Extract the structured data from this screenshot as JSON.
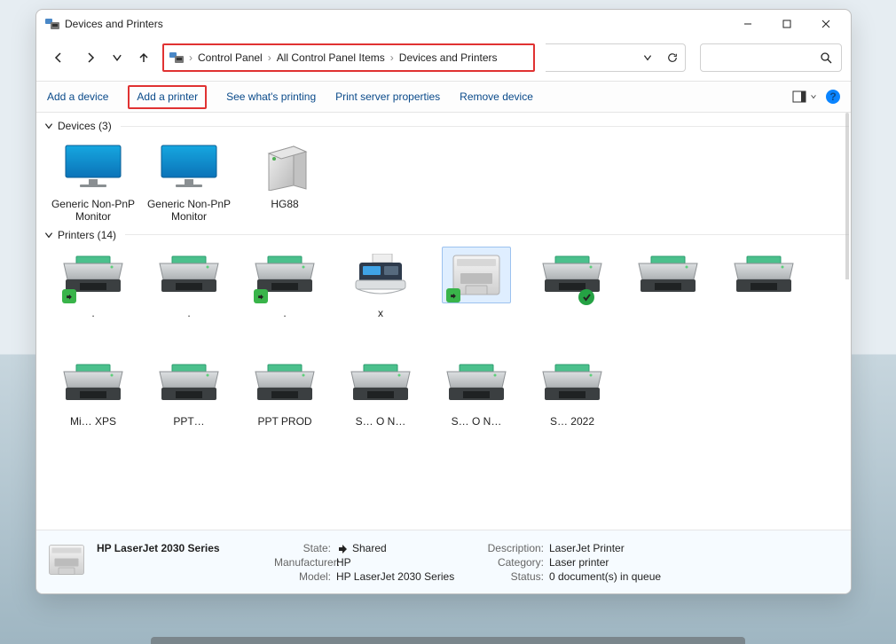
{
  "title": "Devices and Printers",
  "breadcrumbs": [
    "Control Panel",
    "All Control Panel Items",
    "Devices and Printers"
  ],
  "toolbar": {
    "add_device": "Add a device",
    "add_printer": "Add a printer",
    "see_printing": "See what's printing",
    "server_props": "Print server properties",
    "remove": "Remove device"
  },
  "groups": {
    "devices": {
      "label": "Devices",
      "count": 3,
      "items": [
        {
          "name": "Generic Non-PnP Monitor",
          "icon": "monitor"
        },
        {
          "name": "Generic Non-PnP Monitor",
          "icon": "monitor"
        },
        {
          "name": "HG88",
          "icon": "pc"
        }
      ]
    },
    "printers": {
      "label": "Printers",
      "count": 14,
      "row1": [
        {
          "name": ".",
          "icon": "printer",
          "share": true
        },
        {
          "name": ".",
          "icon": "printer"
        },
        {
          "name": ".",
          "icon": "printer",
          "share": true
        },
        {
          "name": "x",
          "icon": "fax"
        },
        {
          "name": "",
          "icon": "hpbox",
          "share": true,
          "selected": true
        },
        {
          "name": "",
          "icon": "printer",
          "check": true
        },
        {
          "name": "",
          "icon": "printer"
        },
        {
          "name": "",
          "icon": "printer"
        }
      ],
      "row2": [
        {
          "name": "Mi…  XPS",
          "icon": "printer"
        },
        {
          "name": "PPT…",
          "icon": "printer"
        },
        {
          "name": "PPT PROD",
          "icon": "printer"
        },
        {
          "name": "S…  O  N…",
          "icon": "printer"
        },
        {
          "name": "S…  O  N…",
          "icon": "printer"
        },
        {
          "name": "S…  2022",
          "icon": "printer"
        }
      ]
    }
  },
  "details": {
    "name": "HP LaserJet 2030 Series",
    "labels": {
      "state": "State:",
      "manufacturer": "Manufacturer:",
      "model": "Model:",
      "description": "Description:",
      "category": "Category:",
      "status": "Status:"
    },
    "state": "Shared",
    "manufacturer": "HP",
    "model": "HP LaserJet 2030 Series",
    "description": "LaserJet Printer",
    "category": "Laser printer",
    "status": "0 document(s) in queue"
  }
}
